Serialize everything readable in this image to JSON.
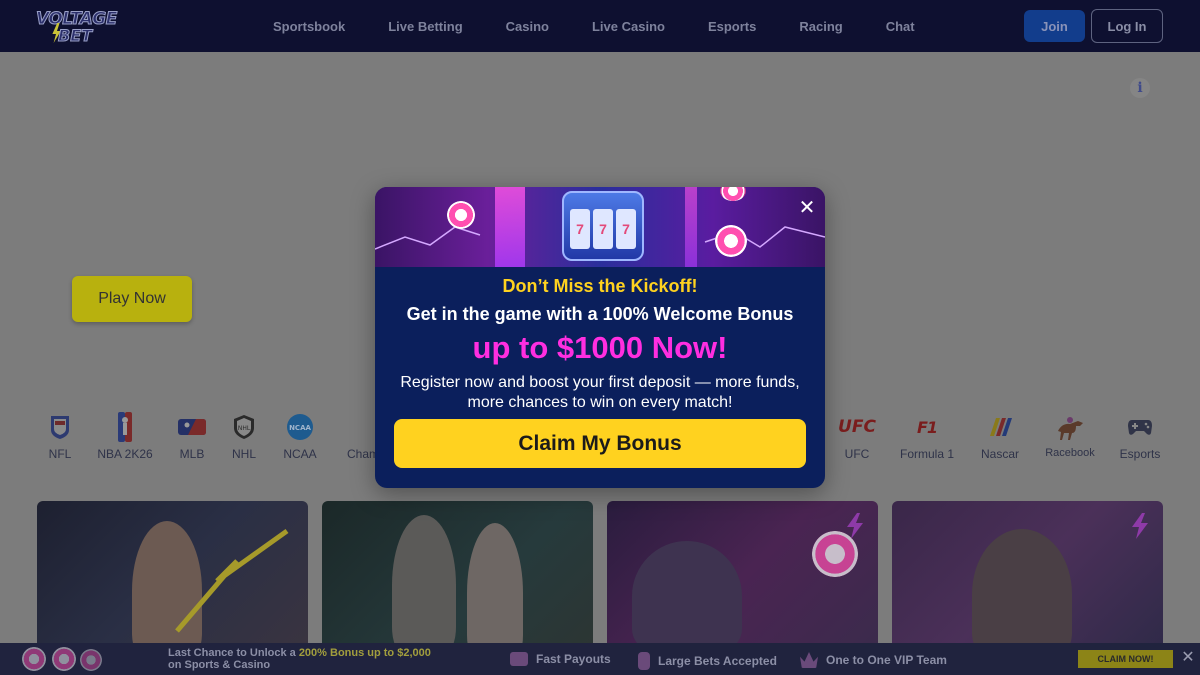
{
  "header": {
    "logo_line1": "VOLTAGE",
    "logo_line2": "BET",
    "nav": [
      "Sportsbook",
      "Live Betting",
      "Casino",
      "Live Casino",
      "Esports",
      "Racing",
      "Chat"
    ],
    "join_label": "Join",
    "login_label": "Log In"
  },
  "info_icon": "i",
  "hero": {
    "play_now_label": "Play Now"
  },
  "sports": [
    {
      "label": "NFL",
      "icon": "nfl-shield-icon"
    },
    {
      "label": "NBA 2K26",
      "icon": "nba-logo-icon"
    },
    {
      "label": "MLB",
      "icon": "mlb-logo-icon"
    },
    {
      "label": "NHL",
      "icon": "nhl-shield-icon"
    },
    {
      "label": "NCAA",
      "icon": "ncaa-badge-icon"
    },
    {
      "label": "Cham",
      "icon": ""
    },
    {
      "label": "UFC",
      "icon": "ufc-logo-icon",
      "text": "UFC"
    },
    {
      "label": "Formula 1",
      "icon": "formula1-logo-icon",
      "text": "F1"
    },
    {
      "label": "Nascar",
      "icon": "nascar-stripes-icon"
    },
    {
      "label": "Racebook",
      "icon": "horse-racing-icon"
    },
    {
      "label": "Esports",
      "icon": "gamepad-icon"
    }
  ],
  "modal": {
    "headline": "Don’t Miss the Kickoff!",
    "subheadline": "Get in the game with a 100% Welcome Bonus",
    "amount_line": "up to $1000 Now!",
    "body_line1": "Register now and boost your first deposit — more funds,",
    "body_line2": "more chances to win on every match!",
    "cta_label": "Claim My Bonus",
    "close_symbol": "✕",
    "slot_reels": [
      "7",
      "7",
      "7"
    ]
  },
  "bottom_bar": {
    "promo_prefix": "Last Chance to Unlock a ",
    "promo_highlight": "200% Bonus up to $2,000",
    "promo_line2": "on Sports & Casino",
    "features": [
      "Fast Payouts",
      "Large Bets Accepted",
      "One to One VIP Team"
    ],
    "claim_label": "CLAIM NOW!",
    "close_symbol": "✕"
  },
  "colors": {
    "header_bg": "#0e1030",
    "overlay_bg": "#7c7c7c",
    "modal_bg": "#0b1f5c",
    "accent_yellow": "#ffd21f",
    "accent_magenta": "#ff2ee0"
  }
}
